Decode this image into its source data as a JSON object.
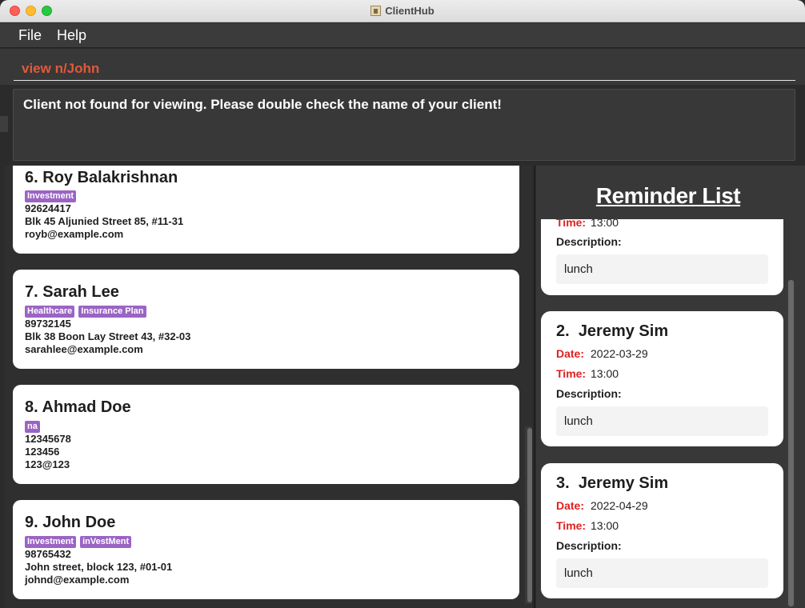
{
  "window": {
    "title": "ClientHub"
  },
  "menu": {
    "file": "File",
    "help": "Help"
  },
  "command": {
    "value": "view n/John"
  },
  "result": {
    "message": "Client not found for viewing. Please double check the name of your client!"
  },
  "clients": [
    {
      "index": "6.",
      "name": "Roy Balakrishnan",
      "tags": [
        "Investment"
      ],
      "phone": "92624417",
      "address": "Blk 45 Aljunied Street 85, #11-31",
      "email": "royb@example.com"
    },
    {
      "index": "7.",
      "name": "Sarah Lee",
      "tags": [
        "Healthcare",
        "Insurance Plan"
      ],
      "phone": "89732145",
      "address": "Blk 38 Boon Lay Street 43, #32-03",
      "email": "sarahlee@example.com"
    },
    {
      "index": "8.",
      "name": "Ahmad Doe",
      "tags": [
        "na"
      ],
      "phone": "12345678",
      "address": "123456",
      "email": "123@123"
    },
    {
      "index": "9.",
      "name": "John Doe",
      "tags": [
        "Investment",
        "inVestMent"
      ],
      "phone": "98765432",
      "address": "John street, block 123, #01-01",
      "email": "johnd@example.com"
    }
  ],
  "reminders": {
    "title": "Reminder List",
    "labels": {
      "date": "Date:",
      "time": "Time:",
      "description": "Description:"
    },
    "items": [
      {
        "index": "",
        "name": "",
        "date": "",
        "time": "13:00",
        "description": "lunch"
      },
      {
        "index": "2.",
        "name": "Jeremy Sim",
        "date": "2022-03-29",
        "time": "13:00",
        "description": "lunch"
      },
      {
        "index": "3.",
        "name": "Jeremy Sim",
        "date": "2022-04-29",
        "time": "13:00",
        "description": "lunch"
      }
    ]
  },
  "colors": {
    "tag": "#9b64c4",
    "command_text": "#e05a3a",
    "reminder_key": "#e02020",
    "background": "#2b2b2b"
  }
}
